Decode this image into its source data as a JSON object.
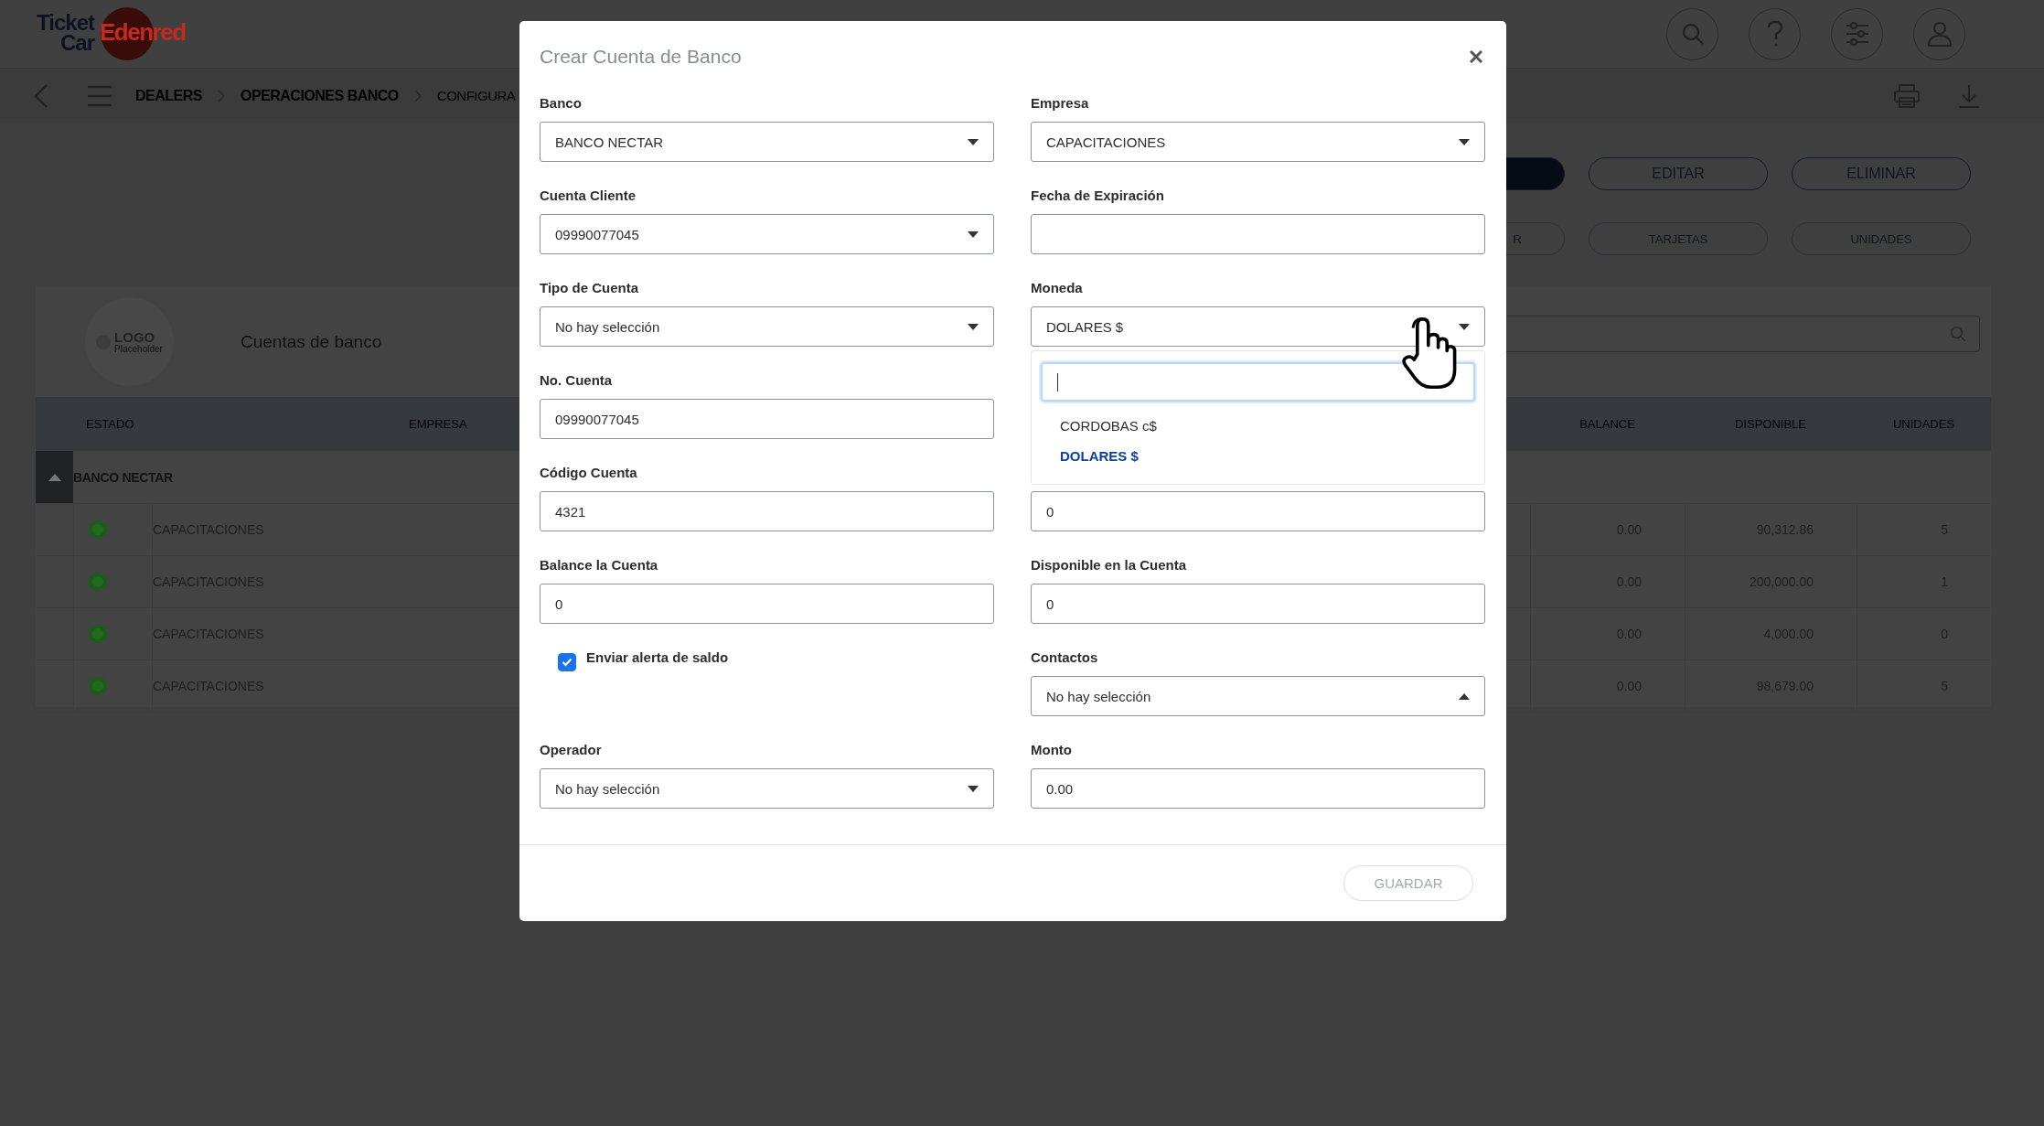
{
  "header": {
    "logo": {
      "line_1": "Ticket",
      "line_2": "Car",
      "brand": "Edenred"
    }
  },
  "breadcrumb": [
    {
      "label": "DEALERS"
    },
    {
      "label": "OPERACIONES BANCO"
    },
    {
      "label": "CONFIGURA"
    }
  ],
  "actions": [
    [
      {
        "kind": "filled"
      },
      {
        "kind": "outline",
        "label": "EDITAR"
      },
      {
        "kind": "outline",
        "label": "ELIMINAR"
      }
    ],
    [
      {
        "kind": "outline",
        "label": "R"
      },
      {
        "kind": "outline",
        "label": "TARJETAS"
      },
      {
        "kind": "outline",
        "label": "UNIDADES"
      }
    ]
  ],
  "card": {
    "logo_placeholder": {
      "title": "LOGO",
      "subtitle": "Placeholder"
    },
    "title": "Cuentas de banco",
    "table": {
      "columns": [
        "ESTADO",
        "EMPRESA",
        "BALANCE",
        "DISPONIBLE",
        "UNIDADES"
      ],
      "group": {
        "label": "BANCO NECTAR",
        "expanded": true
      },
      "rows": [
        {
          "color": "#1f6a1c",
          "empresa": "CAPACITACIONES",
          "balance": "0.00",
          "disponible": "90,312.86",
          "unidades": "5"
        },
        {
          "color": "#1f6a1c",
          "empresa": "CAPACITACIONES",
          "balance": "0.00",
          "disponible": "200,000.00",
          "unidades": "1"
        },
        {
          "color": "#1f6a1c",
          "empresa": "CAPACITACIONES",
          "balance": "0.00",
          "disponible": "4,000.00",
          "unidades": "0"
        },
        {
          "color": "#1f6a1c",
          "empresa": "CAPACITACIONES",
          "balance": "0.00",
          "disponible": "98,679.00",
          "unidades": "5"
        }
      ]
    }
  },
  "modal": {
    "title": "Crear Cuenta de Banco",
    "fields": [
      {
        "kind": "select",
        "label": "Banco",
        "value": "BANCO NECTAR",
        "expanded": false
      },
      {
        "kind": "select",
        "label": "Empresa",
        "value": "CAPACITACIONES",
        "expanded": false
      },
      {
        "kind": "select",
        "label": "Cuenta Cliente",
        "value": "09990077045",
        "expanded": false
      },
      {
        "kind": "input",
        "label": "Fecha de Expiración"
      },
      {
        "kind": "select",
        "label": "Tipo de Cuenta",
        "value": "No hay selección",
        "expanded": false
      },
      {
        "kind": "select",
        "label": "Moneda",
        "value": "DOLARES $",
        "expanded": false,
        "dropdown": {
          "options": [
            {
              "label": "CORDOBAS c$",
              "selected": false
            },
            {
              "label": "DOLARES $",
              "selected": true
            }
          ]
        }
      },
      {
        "kind": "input",
        "label": "No. Cuenta",
        "value": "09990077045"
      },
      {
        "kind": "blank"
      },
      {
        "kind": "input",
        "label": "Código Cuenta",
        "value": "4321"
      },
      {
        "kind": "input",
        "value": "0"
      },
      {
        "kind": "input",
        "label": "Balance la Cuenta",
        "value": "0"
      },
      {
        "kind": "input",
        "label": "Disponible en la Cuenta",
        "value": "0"
      },
      {
        "kind": "checkbox",
        "label": "Enviar alerta de saldo",
        "checked": true
      },
      {
        "kind": "select",
        "label": "Contactos",
        "value": "No hay selección",
        "expanded": true
      },
      {
        "kind": "select",
        "label": "Operador",
        "value": "No hay selección",
        "expanded": false
      },
      {
        "kind": "input",
        "label": "Monto",
        "value": "0.00"
      }
    ],
    "save_button": {
      "label": "GUARDAR",
      "disabled": true
    }
  }
}
